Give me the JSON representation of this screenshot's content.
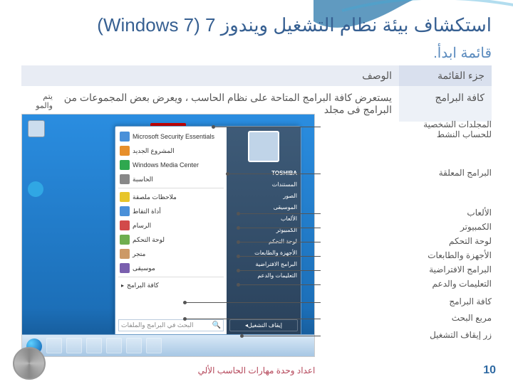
{
  "slide_title": "استكشاف بيئة نظام التشغيل ويندوز 7 (Windows 7)",
  "sub_title": "قائمة ابدأ.",
  "table": {
    "header_col1": "جزء القائمة",
    "header_col2": "الوصف",
    "row1_col1": "كافة البرامج",
    "row1_col2": "يستعرض كافة البرامج المتاحة على نظام الحاسب ، ويعرض بعض المجموعات من البرامج فى مجلد",
    "row1_col3_a": "يتم",
    "row1_col3_b": "والمو"
  },
  "start_menu": {
    "apps": [
      "Microsoft Security Essentials",
      "المشروع الجديد",
      "Windows Media Center",
      "الحاسبة",
      "ملاحظات ملصقة",
      "أداة التقاط",
      "الرسام",
      "لوحة التحكم",
      "متجر",
      "موسيقى"
    ],
    "all_programs": "كافة البرامج",
    "search_placeholder": "البحث في البرامج والملفات",
    "right": {
      "user": "TOSHIBA",
      "items": [
        "المستندات",
        "الصور",
        "الموسيقى",
        "الألعاب",
        "الكمبيوتر",
        "لوحة التحكم",
        "الأجهزة والطابعات",
        "البرامج الافتراضية",
        "التعليمات والدعم"
      ],
      "shutdown": "إيقاف التشغيل"
    }
  },
  "callouts": {
    "personal": "المجلدات الشخصية\nللحساب النشط",
    "pinned": "البرامج المعلقة",
    "games": "الألعاب",
    "computer": "الكمبيوتر",
    "control": "لوحة التحكم",
    "devices": "الأجهزة والطابعات",
    "defaults": "البرامج الافتراضية",
    "help": "التعليمات والدعم",
    "allprog": "كافة البرامج",
    "search": "مربع البحث",
    "shutdown": "زر إيقاف التشغيل"
  },
  "footer": {
    "text": "اعداد وحدة مهارات الحاسب الألي",
    "page": "10"
  }
}
